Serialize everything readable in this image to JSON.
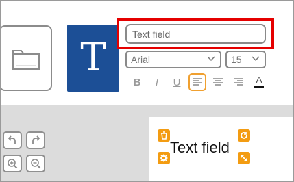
{
  "text_field": {
    "value": "Text field",
    "placeholder": ""
  },
  "tools": {
    "text_tool_glyph": "T"
  },
  "font": {
    "family": "Arial",
    "size": "15"
  },
  "format": {
    "bold": "B",
    "italic": "I",
    "underline": "U",
    "color": "A",
    "active": "align-left"
  },
  "canvas": {
    "text": "Text field"
  },
  "colors": {
    "accent": "#1c4f96",
    "highlight": "#e50000",
    "handle": "#f39c12"
  },
  "icons": {
    "folder": "folder-icon",
    "text_tool": "text-tool-icon",
    "undo": "undo-icon",
    "redo": "redo-icon",
    "zoom_in": "zoom-in-icon",
    "zoom_out": "zoom-out-icon",
    "delete": "trash-icon",
    "rotate": "rotate-icon",
    "settings": "gear-icon",
    "resize": "resize-icon"
  }
}
